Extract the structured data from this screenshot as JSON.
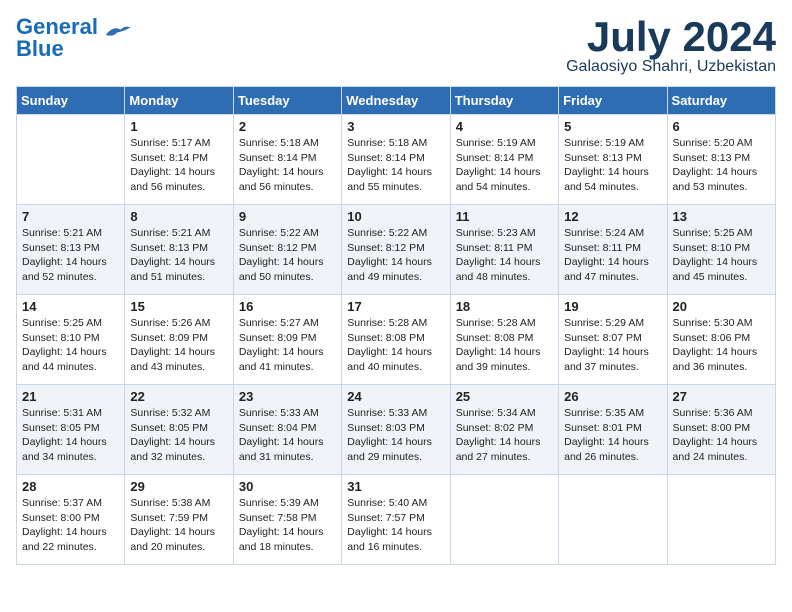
{
  "logo": {
    "line1": "General",
    "line2": "Blue"
  },
  "header": {
    "month": "July 2024",
    "location": "Galaosiyo Shahri, Uzbekistan"
  },
  "weekdays": [
    "Sunday",
    "Monday",
    "Tuesday",
    "Wednesday",
    "Thursday",
    "Friday",
    "Saturday"
  ],
  "weeks": [
    [
      {
        "day": "",
        "sunrise": "",
        "sunset": "",
        "daylight": ""
      },
      {
        "day": "1",
        "sunrise": "Sunrise: 5:17 AM",
        "sunset": "Sunset: 8:14 PM",
        "daylight": "Daylight: 14 hours and 56 minutes."
      },
      {
        "day": "2",
        "sunrise": "Sunrise: 5:18 AM",
        "sunset": "Sunset: 8:14 PM",
        "daylight": "Daylight: 14 hours and 56 minutes."
      },
      {
        "day": "3",
        "sunrise": "Sunrise: 5:18 AM",
        "sunset": "Sunset: 8:14 PM",
        "daylight": "Daylight: 14 hours and 55 minutes."
      },
      {
        "day": "4",
        "sunrise": "Sunrise: 5:19 AM",
        "sunset": "Sunset: 8:14 PM",
        "daylight": "Daylight: 14 hours and 54 minutes."
      },
      {
        "day": "5",
        "sunrise": "Sunrise: 5:19 AM",
        "sunset": "Sunset: 8:13 PM",
        "daylight": "Daylight: 14 hours and 54 minutes."
      },
      {
        "day": "6",
        "sunrise": "Sunrise: 5:20 AM",
        "sunset": "Sunset: 8:13 PM",
        "daylight": "Daylight: 14 hours and 53 minutes."
      }
    ],
    [
      {
        "day": "7",
        "sunrise": "Sunrise: 5:21 AM",
        "sunset": "Sunset: 8:13 PM",
        "daylight": "Daylight: 14 hours and 52 minutes."
      },
      {
        "day": "8",
        "sunrise": "Sunrise: 5:21 AM",
        "sunset": "Sunset: 8:13 PM",
        "daylight": "Daylight: 14 hours and 51 minutes."
      },
      {
        "day": "9",
        "sunrise": "Sunrise: 5:22 AM",
        "sunset": "Sunset: 8:12 PM",
        "daylight": "Daylight: 14 hours and 50 minutes."
      },
      {
        "day": "10",
        "sunrise": "Sunrise: 5:22 AM",
        "sunset": "Sunset: 8:12 PM",
        "daylight": "Daylight: 14 hours and 49 minutes."
      },
      {
        "day": "11",
        "sunrise": "Sunrise: 5:23 AM",
        "sunset": "Sunset: 8:11 PM",
        "daylight": "Daylight: 14 hours and 48 minutes."
      },
      {
        "day": "12",
        "sunrise": "Sunrise: 5:24 AM",
        "sunset": "Sunset: 8:11 PM",
        "daylight": "Daylight: 14 hours and 47 minutes."
      },
      {
        "day": "13",
        "sunrise": "Sunrise: 5:25 AM",
        "sunset": "Sunset: 8:10 PM",
        "daylight": "Daylight: 14 hours and 45 minutes."
      }
    ],
    [
      {
        "day": "14",
        "sunrise": "Sunrise: 5:25 AM",
        "sunset": "Sunset: 8:10 PM",
        "daylight": "Daylight: 14 hours and 44 minutes."
      },
      {
        "day": "15",
        "sunrise": "Sunrise: 5:26 AM",
        "sunset": "Sunset: 8:09 PM",
        "daylight": "Daylight: 14 hours and 43 minutes."
      },
      {
        "day": "16",
        "sunrise": "Sunrise: 5:27 AM",
        "sunset": "Sunset: 8:09 PM",
        "daylight": "Daylight: 14 hours and 41 minutes."
      },
      {
        "day": "17",
        "sunrise": "Sunrise: 5:28 AM",
        "sunset": "Sunset: 8:08 PM",
        "daylight": "Daylight: 14 hours and 40 minutes."
      },
      {
        "day": "18",
        "sunrise": "Sunrise: 5:28 AM",
        "sunset": "Sunset: 8:08 PM",
        "daylight": "Daylight: 14 hours and 39 minutes."
      },
      {
        "day": "19",
        "sunrise": "Sunrise: 5:29 AM",
        "sunset": "Sunset: 8:07 PM",
        "daylight": "Daylight: 14 hours and 37 minutes."
      },
      {
        "day": "20",
        "sunrise": "Sunrise: 5:30 AM",
        "sunset": "Sunset: 8:06 PM",
        "daylight": "Daylight: 14 hours and 36 minutes."
      }
    ],
    [
      {
        "day": "21",
        "sunrise": "Sunrise: 5:31 AM",
        "sunset": "Sunset: 8:05 PM",
        "daylight": "Daylight: 14 hours and 34 minutes."
      },
      {
        "day": "22",
        "sunrise": "Sunrise: 5:32 AM",
        "sunset": "Sunset: 8:05 PM",
        "daylight": "Daylight: 14 hours and 32 minutes."
      },
      {
        "day": "23",
        "sunrise": "Sunrise: 5:33 AM",
        "sunset": "Sunset: 8:04 PM",
        "daylight": "Daylight: 14 hours and 31 minutes."
      },
      {
        "day": "24",
        "sunrise": "Sunrise: 5:33 AM",
        "sunset": "Sunset: 8:03 PM",
        "daylight": "Daylight: 14 hours and 29 minutes."
      },
      {
        "day": "25",
        "sunrise": "Sunrise: 5:34 AM",
        "sunset": "Sunset: 8:02 PM",
        "daylight": "Daylight: 14 hours and 27 minutes."
      },
      {
        "day": "26",
        "sunrise": "Sunrise: 5:35 AM",
        "sunset": "Sunset: 8:01 PM",
        "daylight": "Daylight: 14 hours and 26 minutes."
      },
      {
        "day": "27",
        "sunrise": "Sunrise: 5:36 AM",
        "sunset": "Sunset: 8:00 PM",
        "daylight": "Daylight: 14 hours and 24 minutes."
      }
    ],
    [
      {
        "day": "28",
        "sunrise": "Sunrise: 5:37 AM",
        "sunset": "Sunset: 8:00 PM",
        "daylight": "Daylight: 14 hours and 22 minutes."
      },
      {
        "day": "29",
        "sunrise": "Sunrise: 5:38 AM",
        "sunset": "Sunset: 7:59 PM",
        "daylight": "Daylight: 14 hours and 20 minutes."
      },
      {
        "day": "30",
        "sunrise": "Sunrise: 5:39 AM",
        "sunset": "Sunset: 7:58 PM",
        "daylight": "Daylight: 14 hours and 18 minutes."
      },
      {
        "day": "31",
        "sunrise": "Sunrise: 5:40 AM",
        "sunset": "Sunset: 7:57 PM",
        "daylight": "Daylight: 14 hours and 16 minutes."
      },
      {
        "day": "",
        "sunrise": "",
        "sunset": "",
        "daylight": ""
      },
      {
        "day": "",
        "sunrise": "",
        "sunset": "",
        "daylight": ""
      },
      {
        "day": "",
        "sunrise": "",
        "sunset": "",
        "daylight": ""
      }
    ]
  ]
}
